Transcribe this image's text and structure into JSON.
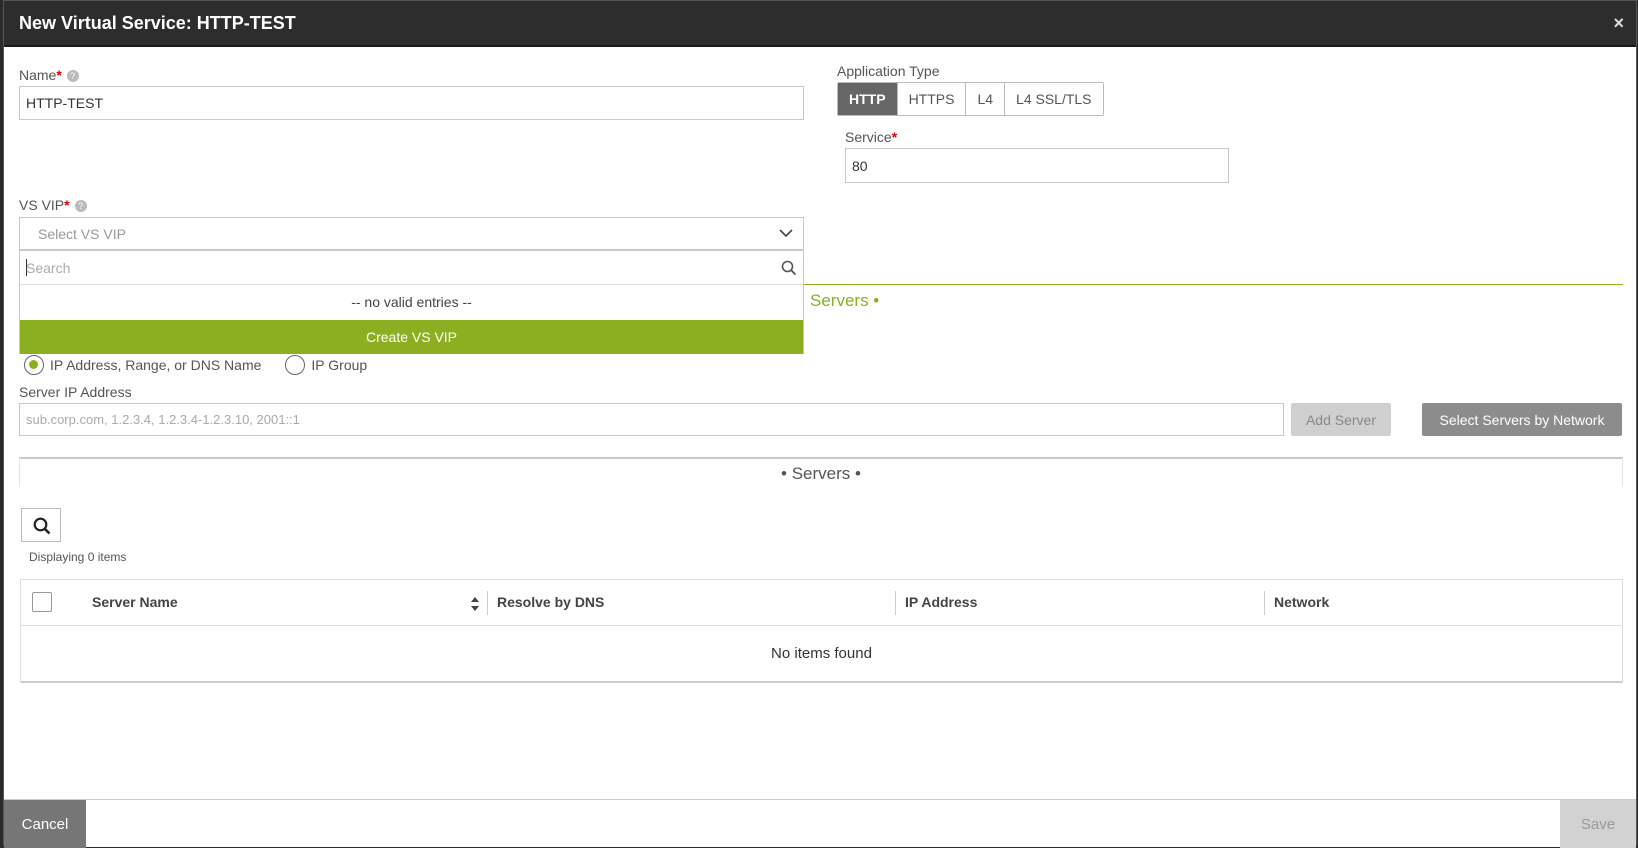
{
  "header": {
    "title": "New Virtual Service: HTTP-TEST",
    "close_label": "×"
  },
  "name_field": {
    "label": "Name",
    "required": "*",
    "value": "HTTP-TEST"
  },
  "application_type": {
    "label": "Application Type",
    "options": [
      "HTTP",
      "HTTPS",
      "L4",
      "L4 SSL/TLS"
    ],
    "selected": "HTTP"
  },
  "service_field": {
    "label": "Service",
    "required": "*",
    "value": "80"
  },
  "vs_vip": {
    "label": "VS VIP",
    "required": "*",
    "placeholder": "Select VS VIP",
    "dropdown": {
      "search_placeholder": "Search",
      "empty_text": "-- no valid entries --",
      "create_label": "Create VS VIP"
    }
  },
  "servers_section": {
    "title_partial": "Servers •"
  },
  "server_type": {
    "options": [
      "IP Address, Range, or DNS Name",
      "IP Group"
    ],
    "selected": "IP Address, Range, or DNS Name"
  },
  "server_ip": {
    "label": "Server IP Address",
    "placeholder": "sub.corp.com, 1.2.3.4, 1.2.3.4-1.2.3.10, 2001::1",
    "add_label": "Add Server",
    "select_network_label": "Select Servers by Network"
  },
  "servers_table": {
    "heading": "• Servers •",
    "count_text": "Displaying 0 items",
    "columns": [
      "Server Name",
      "Resolve by DNS",
      "IP Address",
      "Network"
    ],
    "empty_text": "No items found"
  },
  "footer": {
    "cancel_label": "Cancel",
    "save_label": "Save"
  },
  "colors": {
    "accent": "#8caf22",
    "header_bg": "#2d2d2d"
  }
}
